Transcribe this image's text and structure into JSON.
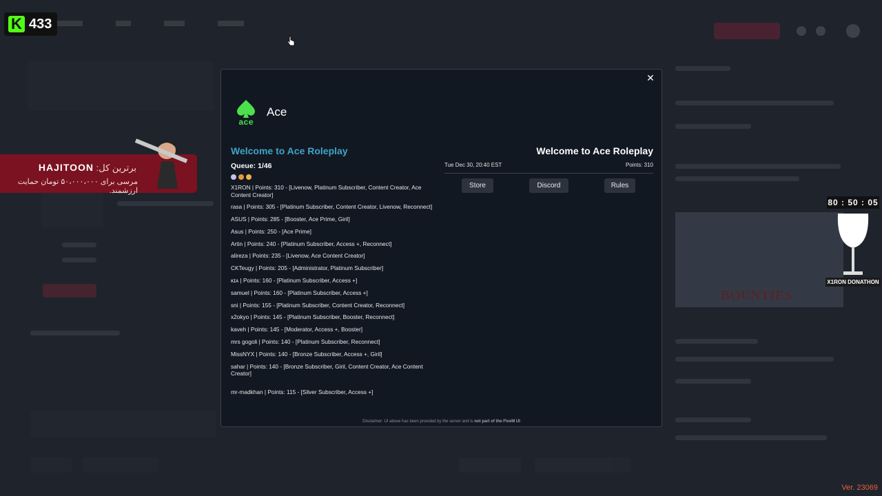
{
  "overlay": {
    "kick_count": "433",
    "donor": {
      "name": "HAJITOON",
      "prefix": "برترین کل:",
      "message": "مرسی برای ۵۰،۰۰۰،۰۰۰ تومان حمایت ارزشمند."
    },
    "timer": "80 : 50 : 05",
    "donathon_label": "X1RON DONATHON",
    "version": "Ver. 23069"
  },
  "modal": {
    "server_name": "Ace",
    "logo_text": "ace",
    "welcome_left": "Welcome to Ace Roleplay",
    "queue": "Queue: 1/46",
    "queue_entries": [
      "X1RON | Points: 310 - [Livenow, Platinum Subscriber, Content Creator, Ace Content Creator]",
      "rasa | Points: 305 - [Platinum Subscriber, Content Creator, Livenow, Reconnect]",
      "ASUS | Points: 285 - [Booster, Ace Prime, Giril]",
      "Asus | Points: 250 - [Ace Prime]",
      "Artin | Points: 240 - [Platinum Subscriber, Access +, Reconnect]",
      "alireza | Points: 235 - [Livenow, Ace Content Creator]",
      "CKTeugy | Points: 205 - [Administrator, Platinum Subscriber]",
      "ĸɪᴀ | Points: 160 - [Platinum Subscriber, Access +]",
      "samuel | Points: 160 - [Platinum Subscriber, Access +]",
      "sni | Points: 155 - [Platinum Subscriber, Content Creator, Reconnect]",
      "x2okyo | Points: 145 - [Platinum Subscriber, Booster, Reconnect]",
      "kaveh | Points: 145 - [Moderator, Access +, Booster]",
      "mrs gogoli | Points: 140 - [Platinum Subscriber, Reconnect]",
      "MissNYX | Points: 140 - [Bronze Subscriber, Access +, Giril]",
      "sahar | Points: 140 - [Bronze Subscriber, Giril, Content Creator, Ace Content Creator]",
      "mr-madkhan | Points: 115 - [Silver Subscriber, Access +]"
    ],
    "welcome_right": "Welcome to Ace Roleplay",
    "datetime": "Tue Dec 30, 20:40 EST",
    "points": "Points: 310",
    "buttons": {
      "store": "Store",
      "discord": "Discord",
      "rules": "Rules"
    },
    "close_symbol": "✕",
    "disclaimer_prefix": "Disclaimer: UI above has been provided by the server and is",
    "disclaimer_bold": "not part of the FiveM UI"
  },
  "colors": {
    "accent_blue": "#3fa4c8",
    "ace_green": "#4de04d",
    "kick_green": "#53fc18",
    "donor_red": "#7a1222",
    "version_orange": "#e8613a"
  },
  "icons": [
    "close-icon",
    "spade-icon",
    "hand-cursor-icon",
    "wine-glass-icon"
  ]
}
